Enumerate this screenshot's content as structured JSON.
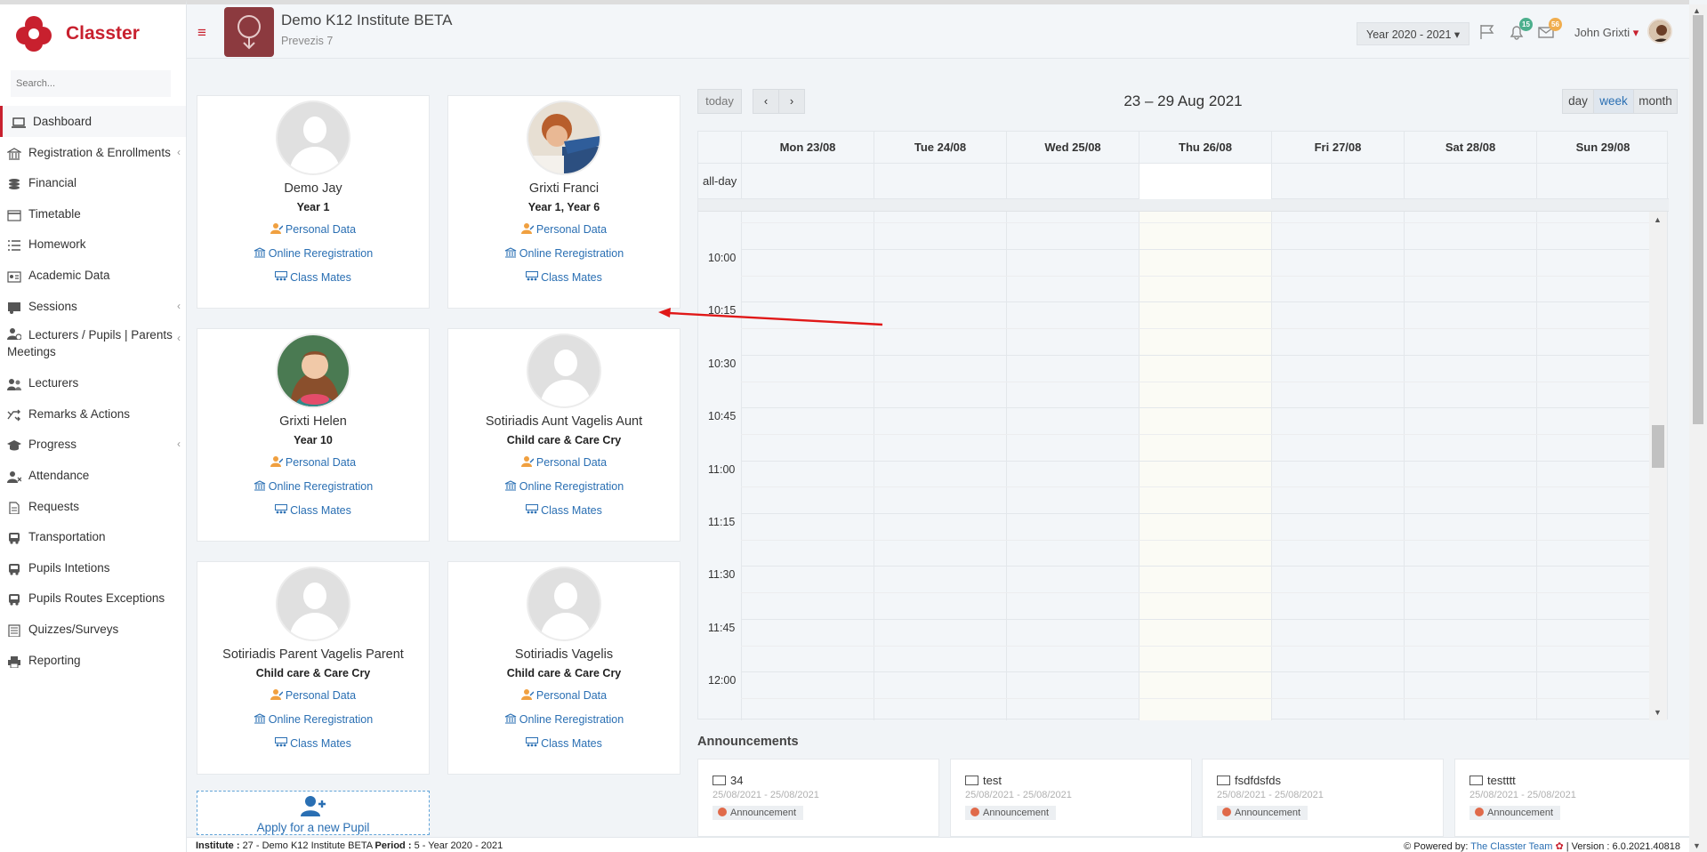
{
  "brand": {
    "name": "Classter",
    "color": "#c8202e"
  },
  "search": {
    "placeholder": "Search..."
  },
  "sidebar": {
    "items": [
      {
        "label": "Dashboard",
        "icon": "laptop-icon",
        "active": true
      },
      {
        "label": "Registration & Enrollments",
        "icon": "institution-icon",
        "has_children": true
      },
      {
        "label": "Financial",
        "icon": "coins-icon"
      },
      {
        "label": "Timetable",
        "icon": "calendar-icon"
      },
      {
        "label": "Homework",
        "icon": "list-icon"
      },
      {
        "label": "Academic Data",
        "icon": "id-card-icon"
      },
      {
        "label": "Sessions",
        "icon": "chalkboard-icon",
        "has_children": true
      },
      {
        "label": "Lecturers / Pupils | Parents Meetings",
        "icon": "user-clock-icon",
        "has_children": true
      },
      {
        "label": "Lecturers",
        "icon": "users-icon"
      },
      {
        "label": "Remarks & Actions",
        "icon": "shuffle-icon"
      },
      {
        "label": "Progress",
        "icon": "graduation-cap-icon",
        "has_children": true
      },
      {
        "label": "Attendance",
        "icon": "user-times-icon"
      },
      {
        "label": "Requests",
        "icon": "file-icon"
      },
      {
        "label": "Transportation",
        "icon": "bus-icon"
      },
      {
        "label": "Pupils Intetions",
        "icon": "bus-icon"
      },
      {
        "label": "Pupils Routes Exceptions",
        "icon": "bus-icon"
      },
      {
        "label": "Quizzes/Surveys",
        "icon": "checklist-icon"
      },
      {
        "label": "Reporting",
        "icon": "printer-icon"
      }
    ]
  },
  "header": {
    "institute_title": "Demo K12 Institute BETA",
    "institute_subtitle": "Prevezis 7",
    "year_select": "Year 2020 - 2021",
    "notifications_count": "15",
    "messages_count": "56",
    "user_name": "John Grixti"
  },
  "pupils": [
    {
      "name": "Demo Jay",
      "year": "Year 1",
      "photo": "placeholder"
    },
    {
      "name": "Grixti Franci",
      "year": "Year 1, Year 6",
      "photo": "boy"
    },
    {
      "name": "Grixti Helen",
      "year": "Year 10",
      "photo": "girl"
    },
    {
      "name": "Sotiriadis Aunt Vagelis Aunt",
      "year": "Child care & Care Cry",
      "photo": "placeholder"
    },
    {
      "name": "Sotiriadis Parent Vagelis Parent",
      "year": "Child care & Care Cry",
      "photo": "placeholder"
    },
    {
      "name": "Sotiriadis Vagelis",
      "year": "Child care & Care Cry",
      "photo": "placeholder"
    }
  ],
  "pupil_links": {
    "personal": "Personal Data",
    "reregistration": "Online Reregistration",
    "classmates": "Class Mates"
  },
  "apply_label": "Apply for a new Pupil",
  "calendar": {
    "today_label": "today",
    "prev_label": "‹",
    "next_label": "›",
    "title": "23 – 29 Aug 2021",
    "views": [
      "day",
      "week",
      "month"
    ],
    "active_view": "week",
    "days": [
      "Mon 23/08",
      "Tue 24/08",
      "Wed 25/08",
      "Thu 26/08",
      "Fri 27/08",
      "Sat 28/08",
      "Sun 29/08"
    ],
    "today_index": 3,
    "allday_label": "all-day",
    "times": [
      "10:00",
      "10:15",
      "10:30",
      "10:45",
      "11:00",
      "11:15",
      "11:30",
      "11:45",
      "12:00"
    ]
  },
  "announcements": {
    "title": "Announcements",
    "items": [
      {
        "title": "34",
        "dates": "25/08/2021 - 25/08/2021",
        "tag": "Announcement"
      },
      {
        "title": "test",
        "dates": "25/08/2021 - 25/08/2021",
        "tag": "Announcement"
      },
      {
        "title": "fsdfdsfds",
        "dates": "25/08/2021 - 25/08/2021",
        "tag": "Announcement"
      },
      {
        "title": "testttt",
        "dates": "25/08/2021 - 25/08/2021",
        "tag": "Announcement"
      }
    ]
  },
  "footer": {
    "institute_label": "Institute :",
    "institute_value": "27 - Demo K12 Institute BETA",
    "period_label": "Period :",
    "period_value": "5 - Year 2020 - 2021",
    "powered_label": "Powered by:",
    "powered_link": "The Classter Team",
    "version_text": "| Version : 6.0.2021.40818"
  }
}
